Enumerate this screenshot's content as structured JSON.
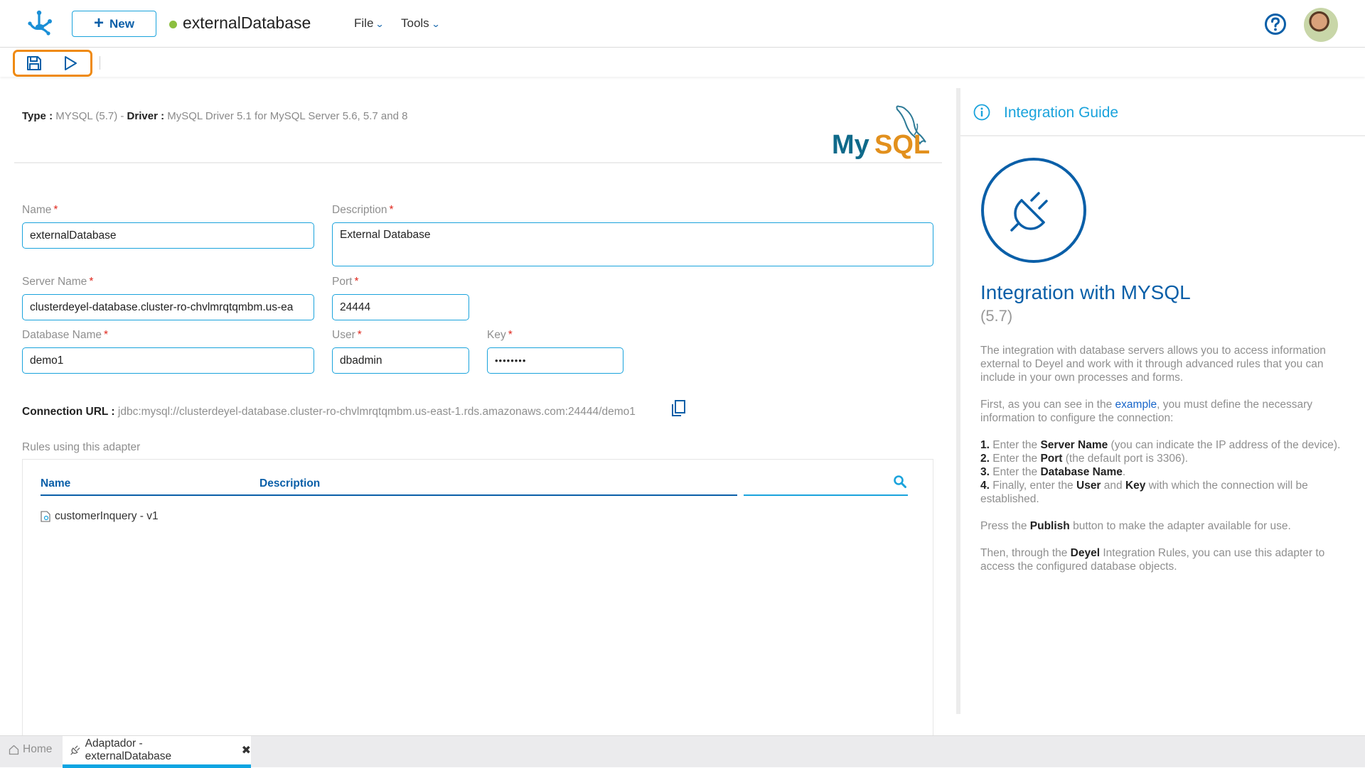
{
  "header": {
    "new_label": "New",
    "doc_title": "externalDatabase",
    "status_color": "#8cbf3f",
    "menus": [
      {
        "label": "File"
      },
      {
        "label": "Tools"
      }
    ],
    "help_icon": "help-circle-icon",
    "avatar": "user-avatar"
  },
  "toolbar": {
    "save_icon": "save-icon",
    "run_icon": "play-icon",
    "highlight_color": "#ef8a12"
  },
  "info": {
    "type_label": "Type :",
    "type_value": "MYSQL (5.7)",
    "separator": "-",
    "driver_label": "Driver :",
    "driver_value": "MySQL Driver 5.1 for MySQL Server 5.6, 5.7 and 8",
    "logo_text_a": "My",
    "logo_text_b": "SQL"
  },
  "form": {
    "name": {
      "label": "Name",
      "value": "externalDatabase"
    },
    "description": {
      "label": "Description",
      "value": "External Database"
    },
    "server_name": {
      "label": "Server Name",
      "value": "clusterdeyel-database.cluster-ro-chvlmrqtqmbm.us-ea"
    },
    "port": {
      "label": "Port",
      "value": "24444"
    },
    "database_name": {
      "label": "Database Name",
      "value": "demo1"
    },
    "user": {
      "label": "User",
      "value": "dbadmin"
    },
    "key": {
      "label": "Key",
      "value": "••••••••"
    },
    "required_mark": "*"
  },
  "connection": {
    "label": "Connection URL :",
    "value": "jdbc:mysql://clusterdeyel-database.cluster-ro-chvlmrqtqmbm.us-east-1.rds.amazonaws.com:24444/demo1"
  },
  "rules": {
    "label": "Rules using this adapter",
    "columns": [
      "Name",
      "Description"
    ],
    "rows": [
      {
        "name": "customerInquery - v1",
        "description": ""
      }
    ]
  },
  "guide": {
    "header": "Integration Guide",
    "title": "Integration with MYSQL",
    "version": "(5.7)",
    "p1": "The integration with database servers allows you to access information external to Deyel and work with it through advanced rules that you can include in your own processes and forms.",
    "p2_a": "First, as you can see in the ",
    "p2_link": "example",
    "p2_b": ", you must define the necessary information to configure the connection:",
    "steps": [
      {
        "num": "1.",
        "pre": " Enter the ",
        "bold": "Server Name",
        "post": " (you can indicate the IP address of the device)."
      },
      {
        "num": "2.",
        "pre": " Enter the ",
        "bold": "Port",
        "post": " (the default port is 3306)."
      },
      {
        "num": "3.",
        "pre": " Enter the ",
        "bold": "Database Name",
        "post": "."
      },
      {
        "num": "4.",
        "pre": " Finally, enter the ",
        "bold": "User",
        "mid": " and ",
        "bold2": "Key",
        "post": " with which the connection will be established."
      }
    ],
    "p3_a": "Press the ",
    "p3_bold": "Publish",
    "p3_b": " button to make the adapter available for use.",
    "p4_a": "Then, through the ",
    "p4_bold": "Deyel",
    "p4_b": " Integration Rules, you can use this adapter to access the configured database objects."
  },
  "tabs": {
    "home": "Home",
    "adapter": "Adaptador - externalDatabase",
    "close": "✖",
    "active_color": "#0ea5e2"
  }
}
